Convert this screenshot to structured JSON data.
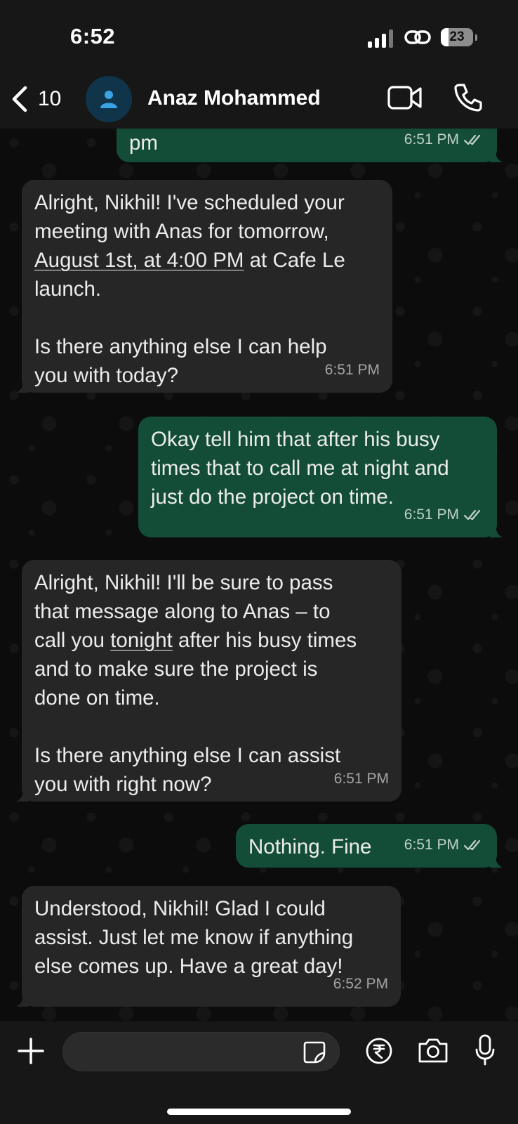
{
  "status_bar": {
    "time": "6:52",
    "battery": "23"
  },
  "header": {
    "back_count": "10",
    "contact_name": "Anaz Mohammed"
  },
  "messages": [
    {
      "dir": "out",
      "text": "pm",
      "time": "6:51 PM"
    },
    {
      "dir": "in",
      "text_pre": "Alright, Nikhil! I've scheduled your\nmeeting with Anas for tomorrow,\n",
      "text_link": "August 1st, at 4:00 PM",
      "text_post": " at Cafe Le\nlaunch.\n\nIs there anything else I can help\nyou with today?",
      "time": "6:51 PM"
    },
    {
      "dir": "out",
      "text": "Okay tell him that after his busy\ntimes that to call me at night and\njust do the project on time.",
      "time": "6:51 PM"
    },
    {
      "dir": "in",
      "text_pre": "Alright, Nikhil! I'll be sure to pass\nthat message along to Anas – to\ncall you ",
      "text_link": "tonight",
      "text_post": " after his busy times\nand to make sure the project is\ndone on time.\n\nIs there anything else I can assist\nyou with right now?",
      "time": "6:51 PM"
    },
    {
      "dir": "out",
      "text": "Nothing. Fine",
      "time": "6:51 PM"
    },
    {
      "dir": "in",
      "text": "Understood, Nikhil! Glad I could\nassist. Just let me know if anything\nelse comes up. Have a great day!",
      "time": "6:52 PM"
    }
  ],
  "composer": {
    "placeholder": ""
  },
  "colors": {
    "incoming": "#262626",
    "outgoing": "#134d37",
    "background": "#0c0c0c",
    "accent": "#3aa3e3"
  }
}
